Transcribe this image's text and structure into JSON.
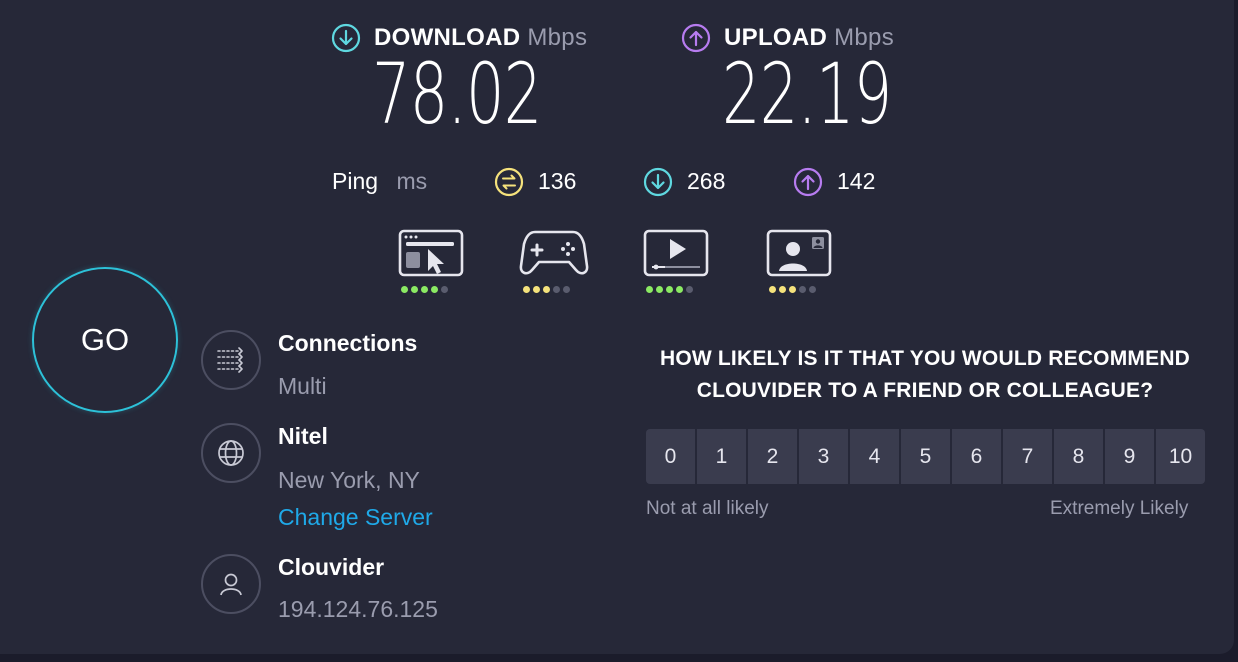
{
  "results": {
    "download": {
      "label": "DOWNLOAD",
      "unit": "Mbps",
      "value": "78.02"
    },
    "upload": {
      "label": "UPLOAD",
      "unit": "Mbps",
      "value": "22.19"
    }
  },
  "ping": {
    "label": "Ping",
    "unit": "ms",
    "idle": "136",
    "download": "268",
    "upload": "142"
  },
  "experience": [
    {
      "icon": "web-browsing-icon",
      "rating": 4,
      "max": 5,
      "color": "#8bea63"
    },
    {
      "icon": "gaming-icon",
      "rating": 3,
      "max": 5,
      "color": "#f5e27c"
    },
    {
      "icon": "video-streaming-icon",
      "rating": 4,
      "max": 5,
      "color": "#8bea63"
    },
    {
      "icon": "video-chat-icon",
      "rating": 3,
      "max": 5,
      "color": "#f5e27c"
    }
  ],
  "go_label": "GO",
  "connections": {
    "title": "Connections",
    "value": "Multi"
  },
  "server": {
    "name": "Nitel",
    "location": "New York, NY",
    "change_label": "Change Server"
  },
  "provider": {
    "name": "Clouvider",
    "ip": "194.124.76.125"
  },
  "survey": {
    "question_line1": "HOW LIKELY IS IT THAT YOU WOULD RECOMMEND",
    "question_line2": "CLOUVIDER TO A FRIEND OR COLLEAGUE?",
    "scale": [
      "0",
      "1",
      "2",
      "3",
      "4",
      "5",
      "6",
      "7",
      "8",
      "9",
      "10"
    ],
    "low_label": "Not at all likely",
    "high_label": "Extremely Likely"
  },
  "colors": {
    "download": "#5fd8e0",
    "upload": "#b77cf0",
    "ping": "#f5e27c",
    "go_ring": "#2dc1d8",
    "link": "#1fa9e8",
    "dot_off": "#5a5c6e"
  }
}
